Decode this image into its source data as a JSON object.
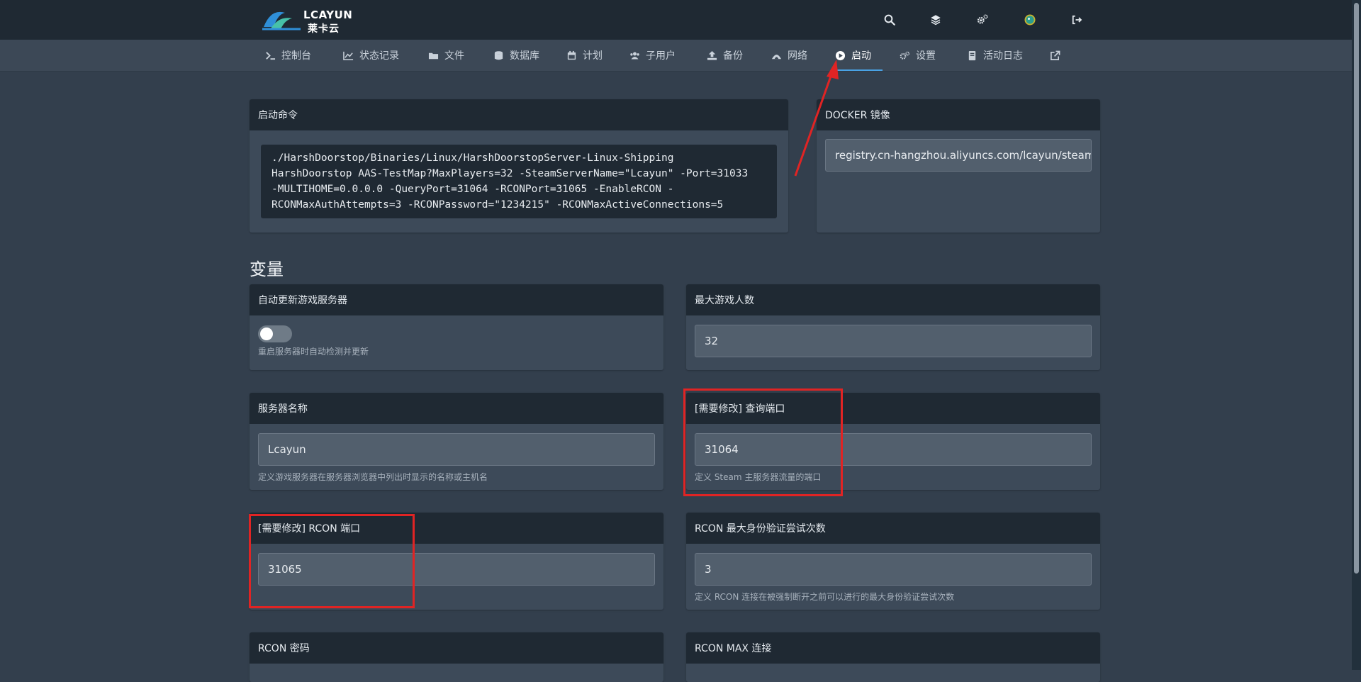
{
  "brand": {
    "logo_text": "LCAYUN",
    "logo_cn": "莱卡云"
  },
  "topbar_icons": [
    "search-icon",
    "layers-icon",
    "gears-icon",
    "avatar",
    "logout-icon"
  ],
  "nav": {
    "items": [
      {
        "label": "控制台",
        "icon": "terminal-icon"
      },
      {
        "label": "状态记录",
        "icon": "chart-icon"
      },
      {
        "label": "文件",
        "icon": "folder-icon"
      },
      {
        "label": "数据库",
        "icon": "database-icon"
      },
      {
        "label": "计划",
        "icon": "calendar-icon"
      },
      {
        "label": "子用户",
        "icon": "users-icon"
      },
      {
        "label": "备份",
        "icon": "upload-icon"
      },
      {
        "label": "网络",
        "icon": "network-icon"
      },
      {
        "label": "启动",
        "icon": "play-icon",
        "active": true
      },
      {
        "label": "设置",
        "icon": "cogs-icon"
      },
      {
        "label": "活动日志",
        "icon": "book-icon"
      },
      {
        "label": "",
        "icon": "external-link-icon"
      }
    ]
  },
  "startup": {
    "title": "启动命令",
    "command": "./HarshDoorstop/Binaries/Linux/HarshDoorstopServer-Linux-Shipping\nHarshDoorstop AAS-TestMap?MaxPlayers=32 -SteamServerName=\"Lcayun\" -Port=31033\n-MULTIHOME=0.0.0.0 -QueryPort=31064 -RCONPort=31065 -EnableRCON -\nRCONMaxAuthAttempts=3 -RCONPassword=\"1234215\" -RCONMaxActiveConnections=5"
  },
  "docker": {
    "title": "DOCKER 镜像",
    "value": "registry.cn-hangzhou.aliyuncs.com/lcayun/steamcmd"
  },
  "variables": {
    "title": "变量",
    "auto_update": {
      "title": "自动更新游戏服务器",
      "enabled": false,
      "help": "重启服务器时自动检测并更新"
    },
    "max_players": {
      "title": "最大游戏人数",
      "value": "32"
    },
    "server_name": {
      "title": "服务器名称",
      "value": "Lcayun",
      "help": "定义游戏服务器在服务器浏览器中列出时显示的名称或主机名"
    },
    "query_port": {
      "title": "[需要修改] 查询端口",
      "value": "31064",
      "help": "定义 Steam 主服务器流量的端口"
    },
    "rcon_port": {
      "title": "[需要修改] RCON 端口",
      "value": "31065"
    },
    "rcon_max_auth": {
      "title": "RCON 最大身份验证尝试次数",
      "value": "3",
      "help": "定义 RCON 连接在被强制断开之前可以进行的最大身份验证尝试次数"
    },
    "rcon_password": {
      "title": "RCON 密码"
    },
    "rcon_max_conn": {
      "title": "RCON MAX 连接"
    }
  },
  "annotation_color": "#e02424",
  "accent_color": "#49a2e5"
}
